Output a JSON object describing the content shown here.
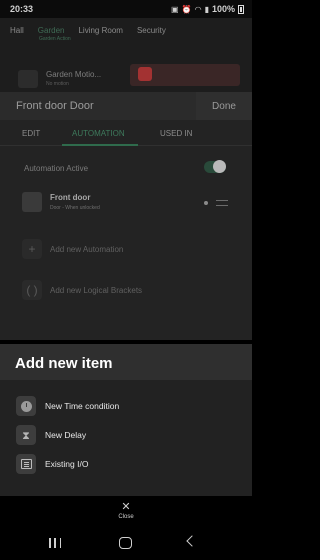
{
  "status_bar": {
    "time": "20:33",
    "battery": "100%",
    "icons": [
      "gallery-icon",
      "alarm-icon",
      "wifi-icon",
      "signal-icon",
      "battery-icon"
    ]
  },
  "background_app": {
    "room_tabs": [
      "Hall",
      "Garden",
      "Living Room",
      "Security"
    ],
    "active_room": "Garden",
    "active_room_sub": "Garden Action",
    "garden_card": {
      "title": "Garden Motio...",
      "subtitle": "No motion"
    }
  },
  "dialog": {
    "title": "Front door Door",
    "done_label": "Done",
    "tabs": [
      "EDIT",
      "AUTOMATION",
      "USED IN"
    ],
    "active_tab": "AUTOMATION",
    "automation_active_label": "Automation Active",
    "automation_active": true,
    "device": {
      "name": "Front door",
      "subtitle": "Door - When unlocked"
    },
    "add_automation_label": "Add new Automation",
    "add_brackets_label": "Add new Logical Brackets"
  },
  "sheet": {
    "title": "Add new item",
    "items": [
      {
        "label": "New Time condition",
        "icon": "clock-icon"
      },
      {
        "label": "New Delay",
        "icon": "hourglass-icon"
      },
      {
        "label": "Existing I/O",
        "icon": "list-icon"
      }
    ],
    "close_label": "Close"
  },
  "colors": {
    "accent": "#2f6b4c",
    "sheet_background": "#222222",
    "sheet_header": "#2f2f2f"
  }
}
